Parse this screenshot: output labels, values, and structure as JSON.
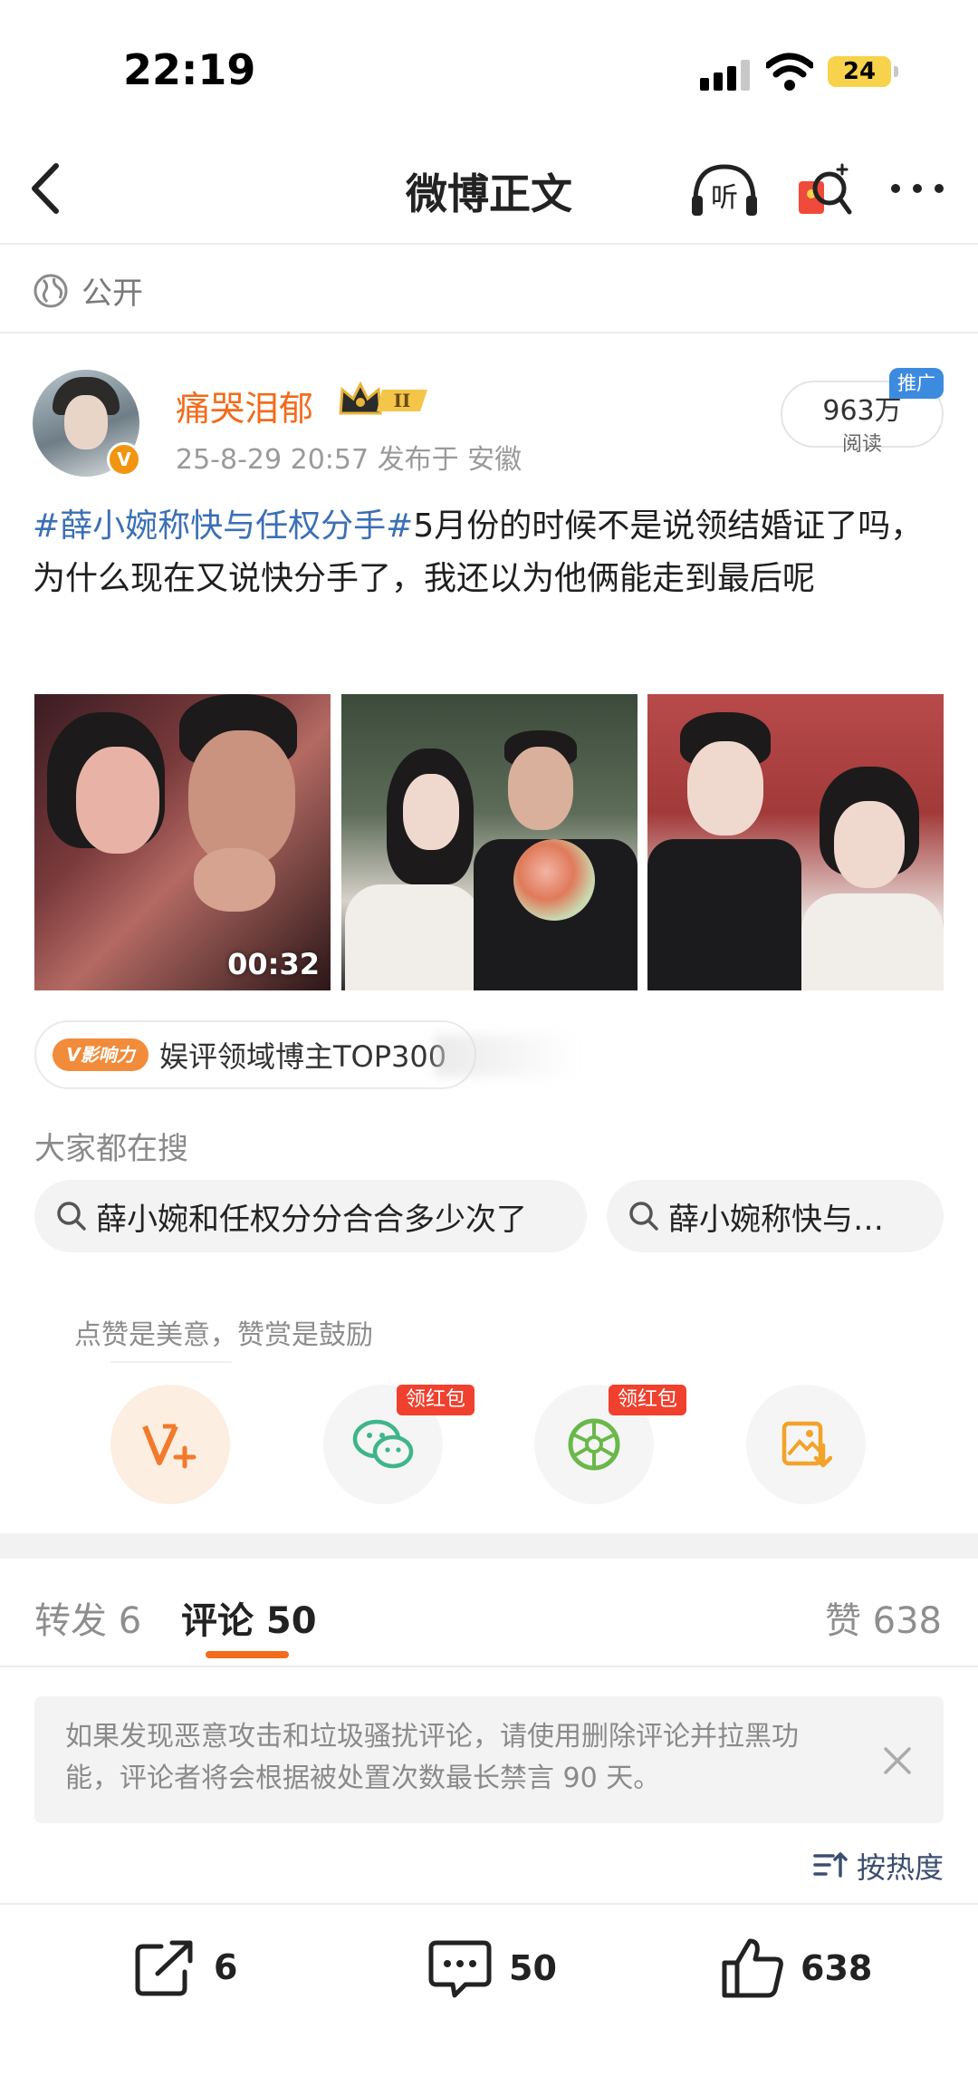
{
  "status_bar": {
    "time": "22:19",
    "battery": "24"
  },
  "nav": {
    "title": "微博正文",
    "listen_label": "听"
  },
  "post": {
    "visibility": "公开",
    "author": {
      "name": "痛哭泪郁",
      "badge_text": "II"
    },
    "meta": "25-8-29 20:57  发布于 安徽",
    "read_count": "963万",
    "read_label": "阅读",
    "promo_tag": "推广",
    "hashtag": "#薛小婉称快与任权分手#",
    "text": "5月份的时候不是说领结婚证了吗，为什么现在又说快分手了，我还以为他俩能走到最后呢",
    "video_duration": "00:32",
    "influence": {
      "badge": "V影响力",
      "text": "娱评领域博主TOP300"
    }
  },
  "trending": {
    "title": "大家都在搜",
    "queries": [
      "薛小婉和任权分分合合多少次了",
      "薛小婉称快与…"
    ]
  },
  "reward": {
    "hint": "点赞是美意，赞赏是鼓励",
    "red_packet_label": "领红包"
  },
  "tabs": {
    "repost": "转发 6",
    "comments": "评论 50",
    "likes": "赞 638"
  },
  "notice": "如果发现恶意攻击和垃圾骚扰评论，请使用删除评论并拉黑功能，评论者将会根据被处置次数最长禁言 90 天。",
  "sort_label": "按热度",
  "bottom_bar": {
    "reposts": "6",
    "comments": "50",
    "likes": "638"
  },
  "colors": {
    "accent": "#f36b1c",
    "hashtag": "#3b6fb6",
    "red_packet": "#f0402e",
    "promo": "#3d8bdf"
  }
}
